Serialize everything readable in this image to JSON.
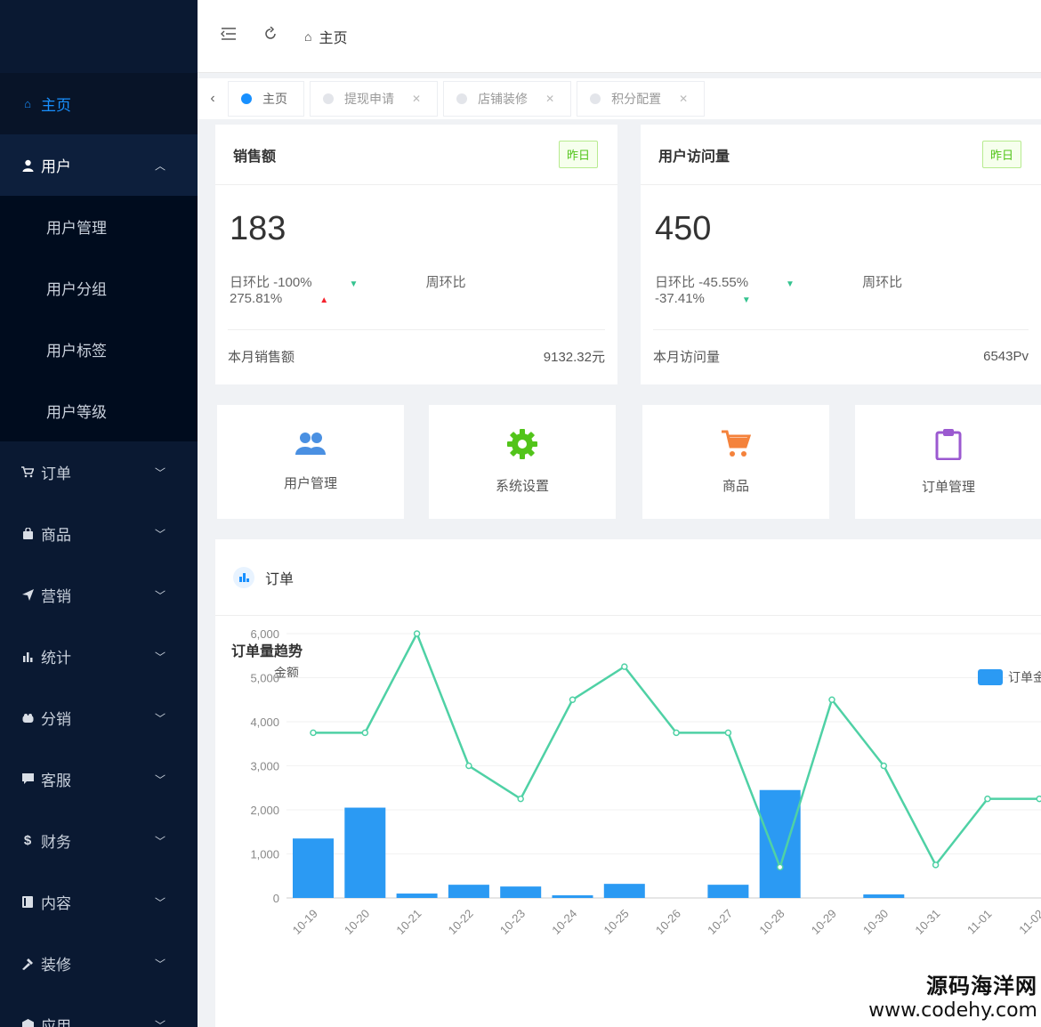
{
  "sidebar": {
    "items": [
      {
        "label": "主页",
        "icon": "home-icon",
        "state": "active"
      },
      {
        "label": "用户",
        "icon": "user-icon",
        "state": "open",
        "children": [
          "用户管理",
          "用户分组",
          "用户标签",
          "用户等级"
        ]
      },
      {
        "label": "订单",
        "icon": "cart-icon"
      },
      {
        "label": "商品",
        "icon": "bag-icon"
      },
      {
        "label": "营销",
        "icon": "send-icon"
      },
      {
        "label": "统计",
        "icon": "bar-chart-icon"
      },
      {
        "label": "分销",
        "icon": "share-icon"
      },
      {
        "label": "客服",
        "icon": "chat-icon"
      },
      {
        "label": "财务",
        "icon": "dollar-icon"
      },
      {
        "label": "内容",
        "icon": "book-icon"
      },
      {
        "label": "装修",
        "icon": "brush-icon"
      },
      {
        "label": "应用",
        "icon": "app-icon"
      }
    ]
  },
  "topbar": {
    "breadcrumb": "主页"
  },
  "tabs": [
    {
      "label": "主页",
      "active": true
    },
    {
      "label": "提现申请"
    },
    {
      "label": "店铺装修"
    },
    {
      "label": "积分配置"
    }
  ],
  "stats": {
    "sales": {
      "title": "销售额",
      "tag": "昨日",
      "value": "183",
      "day": "日环比 -100%",
      "week": "周环比 275.81%",
      "foot_label": "本月销售额",
      "foot_value": "9132.32元"
    },
    "visits": {
      "title": "用户访问量",
      "tag": "昨日",
      "value": "450",
      "day": "日环比 -45.55%",
      "week": "周环比 -37.41%",
      "foot_label": "本月访问量",
      "foot_value": "6543Pv"
    }
  },
  "shortcuts": [
    {
      "label": "用户管理",
      "icon": "users-icon",
      "color": "#4a90e2"
    },
    {
      "label": "系统设置",
      "icon": "gear-icon",
      "color": "#52c41a"
    },
    {
      "label": "商品",
      "icon": "cart-icon",
      "color": "#f4823b"
    },
    {
      "label": "订单管理",
      "icon": "clipboard-icon",
      "color": "#9b59d0"
    }
  ],
  "order_panel": {
    "header": "订单",
    "chart_title": "订单量趋势"
  },
  "chart_data": {
    "type": "bar",
    "title": "订单量趋势",
    "ylabel": "金额",
    "ylim": [
      0,
      6000
    ],
    "yticks": [
      "0",
      "1,000",
      "2,000",
      "3,000",
      "4,000",
      "5,000",
      "6,000"
    ],
    "categories": [
      "10-19",
      "10-20",
      "10-21",
      "10-22",
      "10-23",
      "10-24",
      "10-25",
      "10-26",
      "10-27",
      "10-28",
      "10-29",
      "10-30",
      "10-31",
      "11-01",
      "11-02"
    ],
    "series": [
      {
        "name": "订单金",
        "type": "bar",
        "color": "#2b9af3",
        "values": [
          1350,
          2050,
          100,
          300,
          260,
          60,
          320,
          0,
          300,
          2450,
          0,
          80,
          0,
          0,
          0
        ]
      },
      {
        "type": "line",
        "color": "#4fd1a5",
        "values": [
          3750,
          3750,
          6000,
          3000,
          2250,
          4500,
          5250,
          3750,
          3750,
          700,
          4500,
          3000,
          750,
          2250,
          2250
        ]
      }
    ],
    "legend_position": "top-right"
  },
  "watermark": {
    "line1": "源码海洋网",
    "line2": "www.codehy.com"
  }
}
